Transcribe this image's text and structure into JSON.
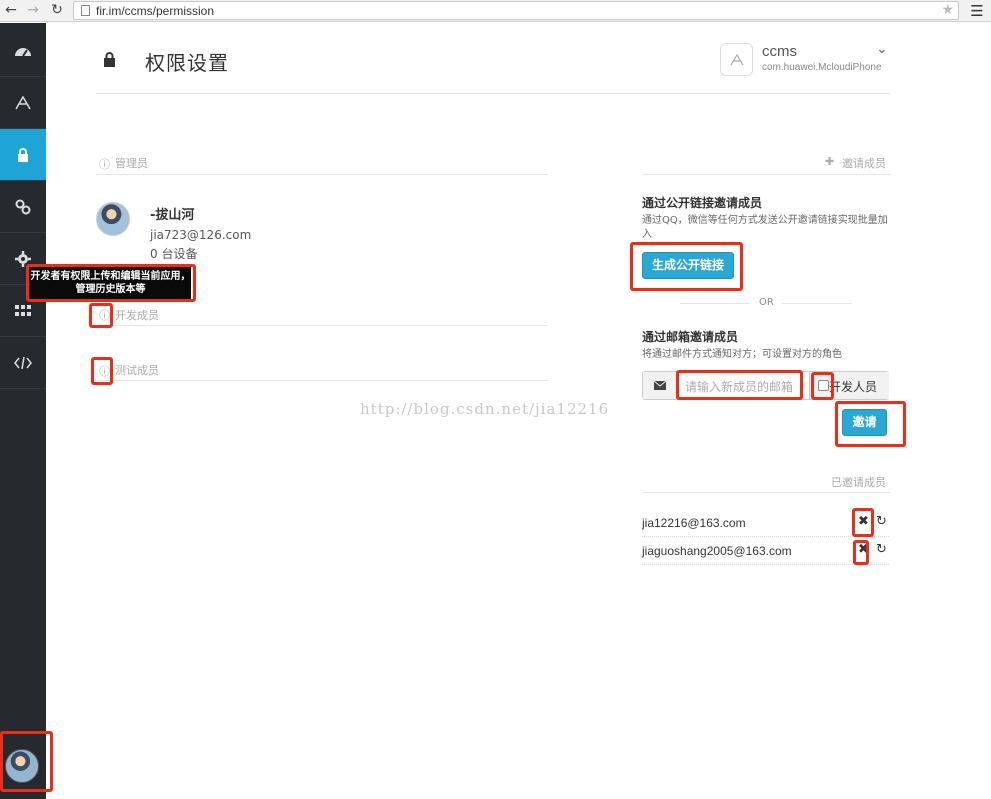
{
  "browser": {
    "url": "fir.im/ccms/permission"
  },
  "header": {
    "title": "权限设置",
    "app_name": "ccms",
    "app_bundle": "com.huawei.McloudiPhone"
  },
  "sections": {
    "admin_title": "管理员",
    "developers_title": "开发成员",
    "testers_title": "测试成员",
    "invite_title": "邀请成员",
    "invited_title": "已邀请成员"
  },
  "admin": {
    "name": "-拔山河",
    "email": "jia723@126.com",
    "devices": "0  台设备"
  },
  "tooltip": {
    "text": "开发者有权限上传和编辑当前应用，管理历史版本等"
  },
  "invite_link": {
    "subtitle": "通过公开链接邀请成员",
    "desc": "通过QQ，微信等任何方式发送公开邀请链接实现批量加入",
    "button": "生成公开链接"
  },
  "or_label": "OR",
  "invite_email": {
    "subtitle": "通过邮箱邀请成员",
    "desc": "将通过邮件方式通知对方；可设置对方的角色",
    "placeholder": "请输入新成员的邮箱",
    "role_label": "开发人员",
    "button": "邀请"
  },
  "invited": [
    {
      "email": "jia12216@163.com"
    },
    {
      "email": "jiaguoshang2005@163.com"
    }
  ],
  "watermark": "http://blog.csdn.net/jia12216",
  "colors": {
    "accent": "#2ba7d3",
    "sidebar": "#262a2e",
    "highlight": "#ec2d17"
  }
}
